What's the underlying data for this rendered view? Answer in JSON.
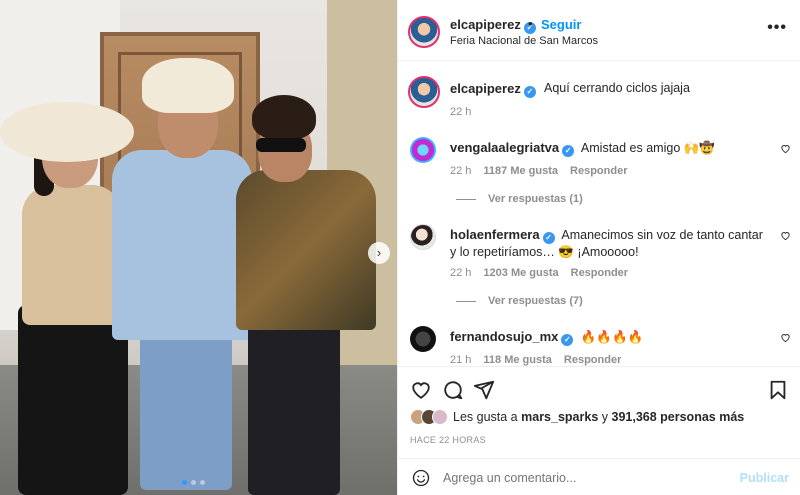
{
  "post": {
    "username": "elcapiperez",
    "follow_label": "Seguir",
    "follow_separator": "•",
    "location": "Feria Nacional de San Marcos",
    "more_label": "•••",
    "caption": "Aquí cerrando ciclos jajaja",
    "caption_time": "22 h"
  },
  "comments": [
    {
      "username": "vengalaalegriatva",
      "text": "Amistad es amigo 🙌🤠",
      "time": "22 h",
      "likes": "1187 Me gusta",
      "reply_label": "Responder",
      "view_replies": "Ver respuestas (1)"
    },
    {
      "username": "holaenfermera",
      "text": "Amanecimos sin voz de tanto cantar y lo repetiríamos… 😎 ¡Amooooo!",
      "time": "22 h",
      "likes": "1203 Me gusta",
      "reply_label": "Responder",
      "view_replies": "Ver respuestas (7)"
    },
    {
      "username": "fernandosujo_mx",
      "text": "🔥🔥🔥🔥",
      "time": "21 h",
      "likes": "118 Me gusta",
      "reply_label": "Responder"
    }
  ],
  "likes": {
    "prefix": "Les gusta a",
    "user": "mars_sparks",
    "connector": "y",
    "count": "391,368 personas más"
  },
  "posted_ago": "HACE 22 HORAS",
  "add_comment": {
    "placeholder": "Agrega un comentario...",
    "publish_label": "Publicar"
  },
  "icons": {
    "carousel_next": "chevron-right-icon",
    "like": "heart-icon",
    "comment": "comment-icon",
    "share": "send-icon",
    "save": "bookmark-icon",
    "emoji": "smile-icon",
    "verified": "verified-badge-icon"
  },
  "colors": {
    "accent": "#0095f6",
    "verified": "#3897f0",
    "publish_disabled": "#b2dffc",
    "muted_text": "#8e8e8e"
  }
}
